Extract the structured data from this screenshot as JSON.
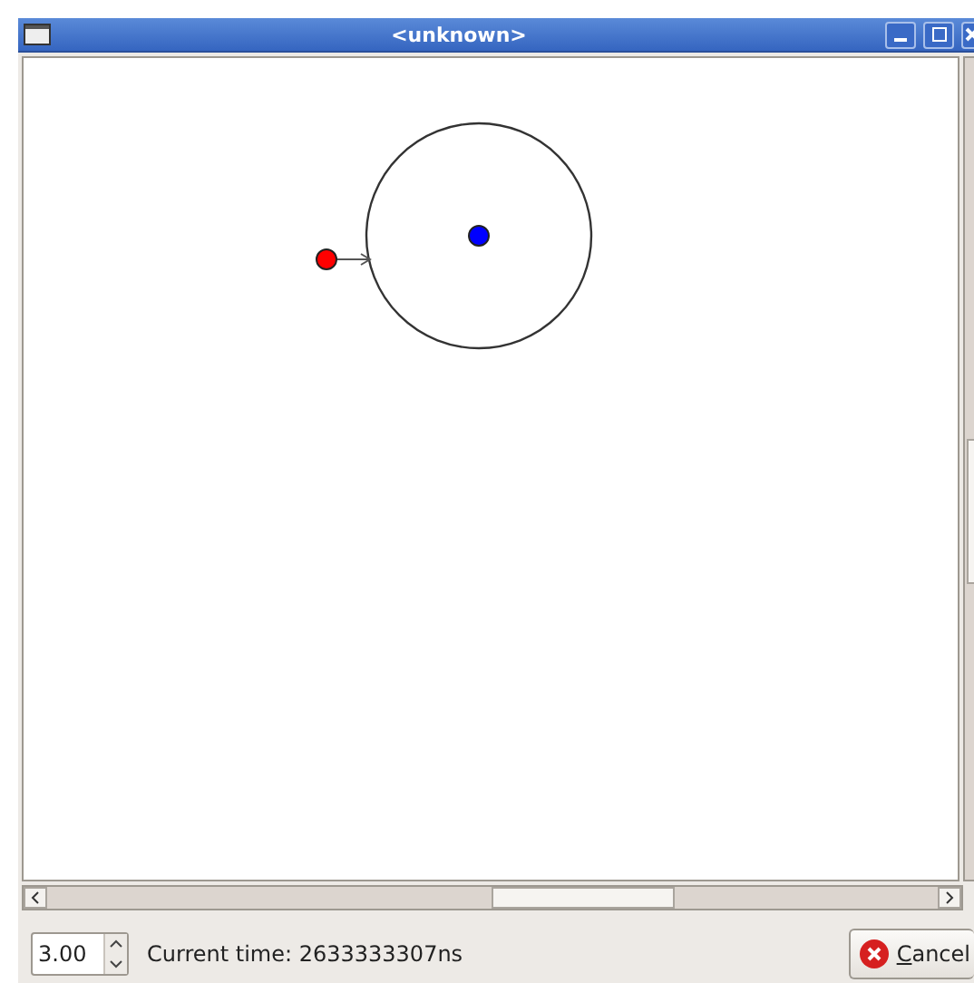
{
  "window": {
    "title": "<unknown>"
  },
  "simulation": {
    "spin_value": "3.00",
    "status": "Current time: 2633333307ns"
  },
  "buttons": [
    {
      "label": "Cancel"
    }
  ]
}
